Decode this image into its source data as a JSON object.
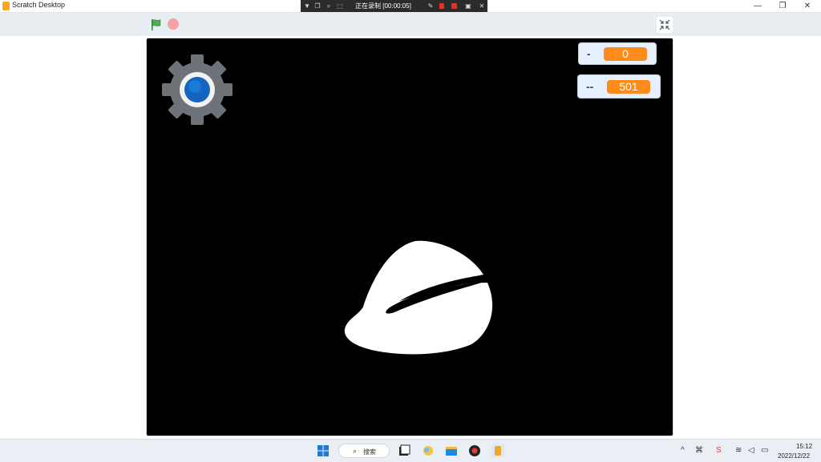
{
  "window": {
    "title": "Scratch Desktop",
    "controls": {
      "minimize": "—",
      "restore": "❐",
      "close": "✕"
    }
  },
  "recording_bar": {
    "status": "正在录制 [00:00:05]"
  },
  "stage": {
    "monitors": [
      {
        "label": "-",
        "value": "0"
      },
      {
        "label": "--",
        "value": "501"
      }
    ]
  },
  "taskbar": {
    "search_label": "搜索",
    "clock_time": "15:12",
    "clock_date": "2022/12/22"
  },
  "colors": {
    "flag": "#4caf50",
    "stop": "#f3a5a5",
    "monitor_value": "#ff8c1a",
    "stage_bg": "#000000"
  },
  "icons": [
    "app-icon",
    "green-flag-icon",
    "stop-icon",
    "exit-fullscreen-icon",
    "gear-icon",
    "leaf-icon",
    "windows-start-icon",
    "search-icon"
  ]
}
